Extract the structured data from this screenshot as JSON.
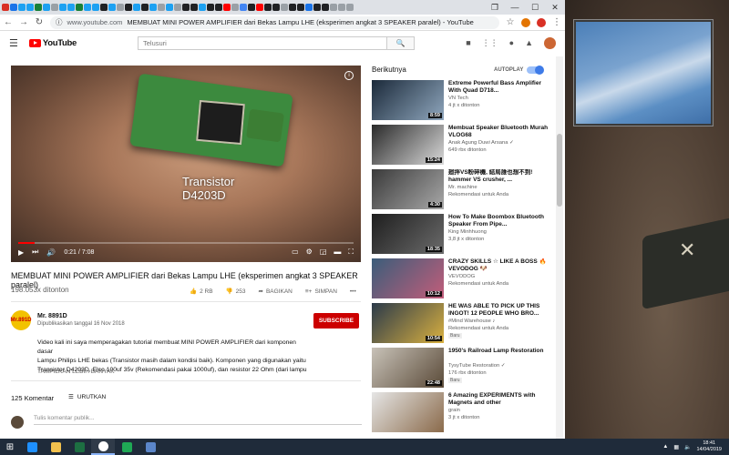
{
  "browser": {
    "url_host": "www.youtube.com",
    "url_title": "MEMBUAT MINI POWER AMPLIFIER dari Bekas Lampu LHE (eksperimen angkat 3 SPEAKER paralel) - YouTube",
    "tab_colors": [
      "#d93025",
      "#1a73e8",
      "#1da1f2",
      "#1da1f2",
      "#188038",
      "#1da1f2",
      "#9aa0a6",
      "#1da1f2",
      "#1da1f2",
      "#188038",
      "#1da1f2",
      "#1da1f2",
      "#202124",
      "#1da1f2",
      "#9aa0a6",
      "#202124",
      "#1da1f2",
      "#202124",
      "#1da1f2",
      "#9aa0a6",
      "#1da1f2",
      "#9aa0a6",
      "#202124",
      "#202124",
      "#1da1f2",
      "#202124",
      "#202124",
      "#ff0000",
      "#9aa0a6",
      "#4285f4",
      "#202124",
      "#ff0000",
      "#202124",
      "#202124",
      "#9aa0a6",
      "#202124",
      "#202124",
      "#1a73e8",
      "#202124",
      "#202124",
      "#9aa0a6",
      "#9aa0a6",
      "#9aa0a6"
    ]
  },
  "header": {
    "logo_text": "YouTube",
    "search_placeholder": "Telusuri"
  },
  "player": {
    "caption_line1": "Transistor",
    "caption_line2": "D4203D",
    "time": "0:21 / 7:08",
    "progress": 0.05
  },
  "video": {
    "title": "MEMBUAT MINI POWER AMPLIFIER dari Bekas Lampu LHE (eksperimen angkat 3 SPEAKER paralel)",
    "views": "198.053x ditonton",
    "likes": "2 RB",
    "dislikes": "253",
    "share_label": "BAGIKAN",
    "save_label": "SIMPAN",
    "more_label": "•••"
  },
  "channel": {
    "name": "Mr. 8891D",
    "avatar_text": "Mr.891D",
    "published": "Dipublikasikan tanggal 16 Nov 2018",
    "subscribe_label": "SUBSCRIBE"
  },
  "description": {
    "line1": "Video kali ini saya memperagakan tutorial membuat MINI POWER AMPLIFIER dari komponen dasar",
    "line2": "Lampu Philips LHE bekas (Transistor masih dalam kondisi baik). Komponen yang digunakan yaitu",
    "line3": "Transistor D4203D, Elco 100uf 35v (Rekomendasi pakai 1000uf), dan resistor 22 Ohm (dari lampu",
    "show_more": "TAMPILKAN LEBIH BANYAK"
  },
  "comments": {
    "count": "125 Komentar",
    "sort_label": "URUTKAN",
    "placeholder": "Tulis komentar publik..."
  },
  "sidebar": {
    "up_next": "Berikutnya",
    "autoplay": "AUTOPLAY",
    "items": [
      {
        "title": "Extreme Powerful Bass Amplifier With Quad D718...",
        "channel": "VN Tech",
        "meta": "4 jt x ditonton",
        "duration": "8:59",
        "badge": "",
        "thumb": [
          "#1b2a3a",
          "#8fa6bd"
        ]
      },
      {
        "title": "Membuat Speaker Bluetooth Murah VLOG68",
        "channel": "Anak Agung Duwi Arsana ✓",
        "meta": "649 rbx ditonton",
        "duration": "15:24",
        "badge": "",
        "thumb": [
          "#2a2a2a",
          "#d9d9d9"
        ]
      },
      {
        "title": "廻拌VS粉碎機, 結局誰也想不到! hammer VS crusher, ...",
        "channel": "Mr. machine",
        "meta": "Rekomendasi untuk Anda",
        "duration": "4:30",
        "badge": "",
        "thumb": [
          "#3a3a3a",
          "#a8a8a8"
        ]
      },
      {
        "title": "How To Make Boombox Bluetooth Speaker From Pipe...",
        "channel": "King Minhhuong",
        "meta": "3,8 jt x ditonton",
        "duration": "18:35",
        "badge": "",
        "thumb": [
          "#1e1e1e",
          "#6b6b6b"
        ]
      },
      {
        "title": "CRAZY SKILLS ☆ LIKE A BOSS 🔥 VEVODOG 🐶",
        "channel": "VEVODOG",
        "meta": "Rekomendasi untuk Anda",
        "duration": "10:12",
        "badge": "",
        "thumb": [
          "#3b5d7a",
          "#c25d7a"
        ]
      },
      {
        "title": "HE WAS ABLE TO PICK UP THIS INGOT! 12 PEOPLE WHO BRO...",
        "channel": "#Mind Warehouse ♪",
        "meta": "Rekomendasi untuk Anda",
        "duration": "10:54",
        "badge": "Baru",
        "thumb": [
          "#2b3a4a",
          "#d9b040"
        ]
      },
      {
        "title": "1950's Railroad Lamp Restoration",
        "channel": "TysyTube Restoration ✓",
        "meta": "176 rbx ditonton",
        "duration": "22:48",
        "badge": "Baru",
        "thumb": [
          "#c8c2b8",
          "#5a4a38"
        ]
      },
      {
        "title": "6 Amazing EXPERIMENTS with Magnets and other",
        "channel": "grain",
        "meta": "3 jt x ditonton",
        "duration": "",
        "badge": "",
        "thumb": [
          "#e6e6e6",
          "#8a6a4a"
        ]
      }
    ]
  },
  "taskbar": {
    "apps": [
      {
        "name": "ie",
        "color": "#1e90ff"
      },
      {
        "name": "explorer",
        "color": "#f2c14e"
      },
      {
        "name": "excel",
        "color": "#1d6f42"
      },
      {
        "name": "yandex",
        "color": "#ffffff"
      },
      {
        "name": "green-app",
        "color": "#1fa855"
      },
      {
        "name": "photos",
        "color": "#5b86c9"
      }
    ],
    "time": "18:41",
    "date": "14/04/2019"
  }
}
